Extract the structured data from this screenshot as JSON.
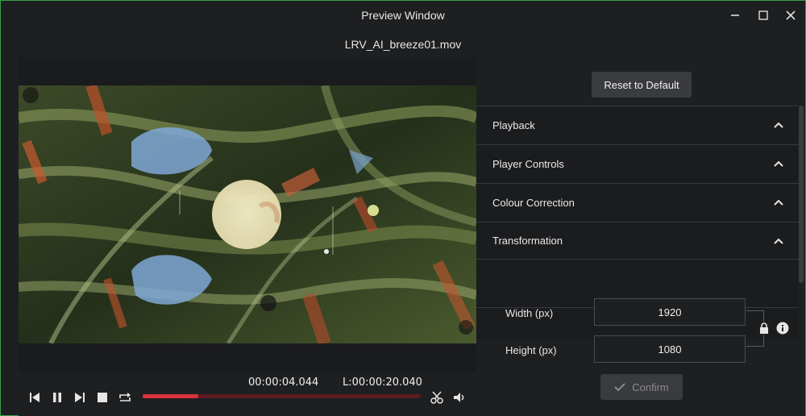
{
  "window": {
    "title": "Preview Window",
    "filename": "LRV_AI_breeze01.mov"
  },
  "player": {
    "current_time": "00:00:04.044",
    "length_time": "L:00:00:20.040",
    "progress_fraction": 0.2,
    "accent_color": "#d9323c"
  },
  "panel": {
    "reset_label": "Reset to Default",
    "sections": [
      {
        "label": "Playback"
      },
      {
        "label": "Player Controls"
      },
      {
        "label": "Colour Correction"
      },
      {
        "label": "Transformation"
      }
    ],
    "width_label": "Width (px)",
    "width_value": "1920",
    "height_label": "Height (px)",
    "height_value": "1080",
    "confirm_label": "Confirm"
  },
  "icons": {
    "minimize": "minimize-icon",
    "maximize": "maximize-icon",
    "close": "close-icon",
    "lock": "lock-icon",
    "info": "info-icon"
  }
}
